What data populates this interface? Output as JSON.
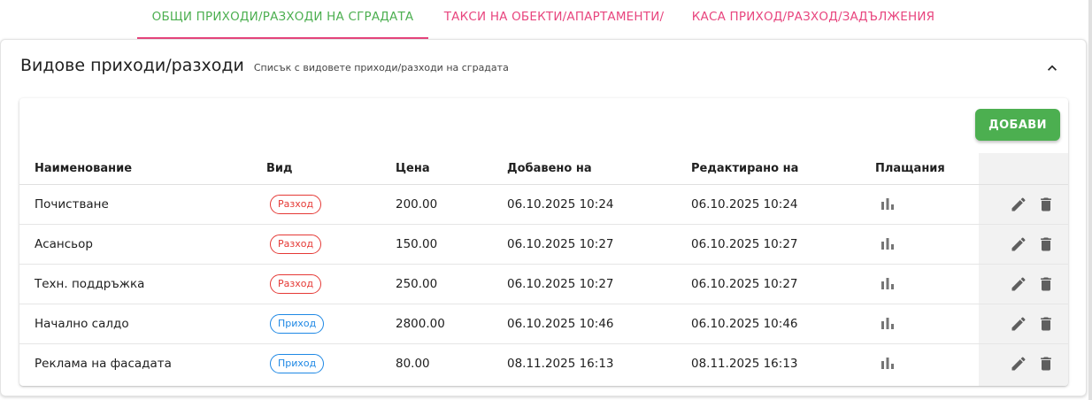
{
  "tabs": [
    {
      "label": "ОБЩИ ПРИХОДИ/РАЗХОДИ НА СГРАДАТА",
      "active": true
    },
    {
      "label": "ТАКСИ НА ОБЕКТИ/АПАРТАМЕНТИ/",
      "active": false
    },
    {
      "label": "КАСА ПРИХОД/РАЗХОД/ЗАДЪЛЖЕНИЯ",
      "active": false
    }
  ],
  "panel": {
    "title": "Видове приходи/разходи",
    "subtitle": "Списък с видовете приходи/разходи на сградата",
    "collapse_icon": "chevron-up-icon"
  },
  "toolbar": {
    "add_label": "ДОБАВИ"
  },
  "table": {
    "headers": {
      "name": "Наименование",
      "type": "Вид",
      "price": "Цена",
      "added": "Добавено на",
      "edited": "Редактирано на",
      "payments": "Плащания"
    },
    "rows": [
      {
        "name": "Почистване",
        "type": "Разход",
        "kind": "expense",
        "price": "200.00",
        "added": "06.10.2025 10:24",
        "edited": "06.10.2025 10:24"
      },
      {
        "name": "Асансьор",
        "type": "Разход",
        "kind": "expense",
        "price": "150.00",
        "added": "06.10.2025 10:27",
        "edited": "06.10.2025 10:27"
      },
      {
        "name": "Техн. поддръжка",
        "type": "Разход",
        "kind": "expense",
        "price": "250.00",
        "added": "06.10.2025 10:27",
        "edited": "06.10.2025 10:27"
      },
      {
        "name": "Начално салдо",
        "type": "Приход",
        "kind": "income",
        "price": "2800.00",
        "added": "06.10.2025 10:46",
        "edited": "06.10.2025 10:46"
      },
      {
        "name": "Реклама на фасадата",
        "type": "Приход",
        "kind": "income",
        "price": "80.00",
        "added": "08.11.2025 16:13",
        "edited": "08.11.2025 16:13"
      }
    ]
  },
  "icons": {
    "payments": "bar-chart-icon",
    "edit": "pencil-icon",
    "delete": "trash-icon"
  },
  "colors": {
    "active_tab_text": "#4caf50",
    "tab_text": "#e8457e",
    "add_button": "#4caf50",
    "expense_chip": "#e53935",
    "income_chip": "#1e88e5"
  }
}
